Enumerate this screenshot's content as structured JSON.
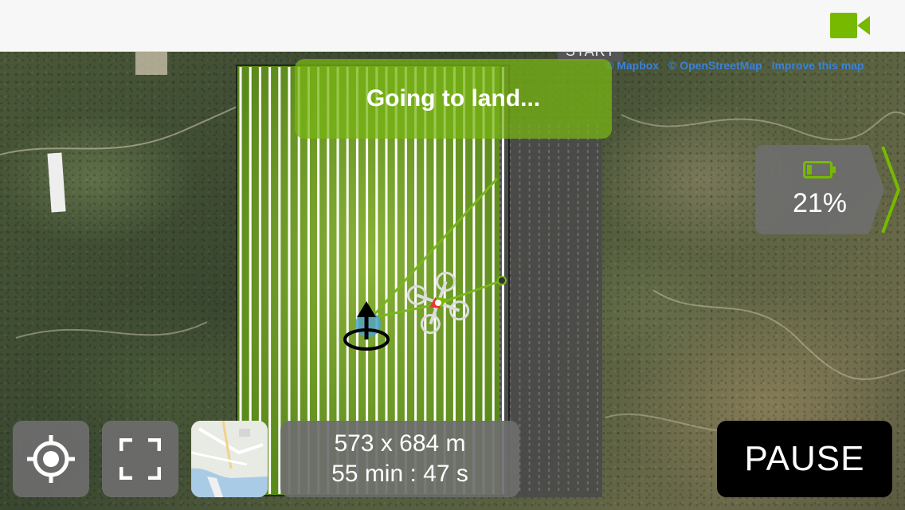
{
  "top_bar": {
    "camera_icon": "video-camera-icon",
    "accent_color": "#76b900"
  },
  "map": {
    "attribution": [
      "© Mapbox",
      "© OpenStreetMap",
      "Improve this map"
    ],
    "start_label": "START",
    "survey_color": "#7ab51d",
    "path_color": "#ffffff"
  },
  "status": {
    "message": "Going to land..."
  },
  "battery": {
    "percent_label": "21%",
    "level_percent": 21,
    "icon": "battery-icon"
  },
  "controls": {
    "locate_icon": "crosshair-icon",
    "fullscreen_icon": "fullscreen-icon",
    "maptype_icon": "map-thumbnail-icon"
  },
  "mission_info": {
    "area": "573 x 684 m",
    "duration": "55 min : 47 s"
  },
  "pause_button": {
    "label": "PAUSE"
  }
}
